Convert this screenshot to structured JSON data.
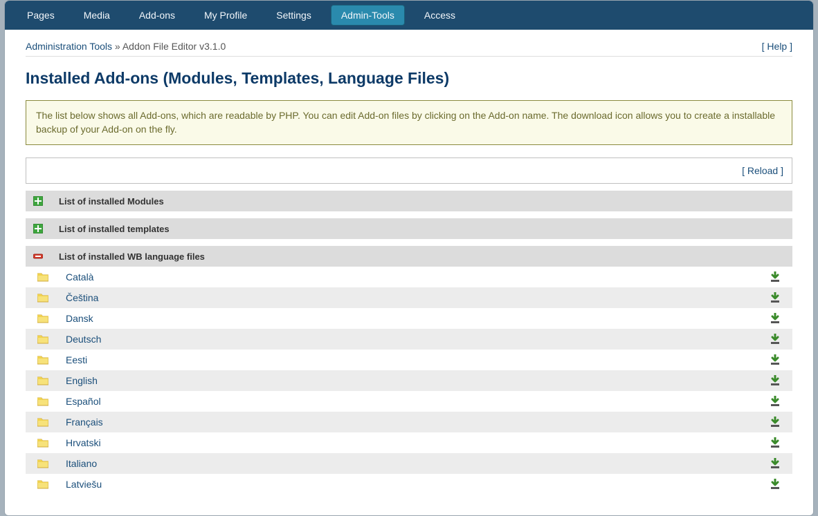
{
  "nav": {
    "items": [
      {
        "label": "Pages",
        "active": false
      },
      {
        "label": "Media",
        "active": false
      },
      {
        "label": "Add-ons",
        "active": false
      },
      {
        "label": "My Profile",
        "active": false
      },
      {
        "label": "Settings",
        "active": false
      },
      {
        "label": "Admin-Tools",
        "active": true
      },
      {
        "label": "Access",
        "active": false
      }
    ]
  },
  "breadcrumb": {
    "root": "Administration Tools",
    "sep": " » ",
    "current": "Addon File Editor v3.1.0"
  },
  "help_label": "[ Help ]",
  "page_title": "Installed Add-ons (Modules, Templates, Language Files)",
  "info_text": "The list below shows all Add-ons, which are readable by PHP. You can edit Add-on files by clicking on the Add-on name. The download icon allows you to create a installable backup of your Add-on on the fly.",
  "reload_label": "[ Reload ]",
  "sections": {
    "modules": {
      "title": "List of installed Modules",
      "expanded": false
    },
    "templates": {
      "title": "List of installed templates",
      "expanded": false
    },
    "languages": {
      "title": "List of installed WB language files",
      "expanded": true
    }
  },
  "languages": [
    {
      "name": "Català"
    },
    {
      "name": "Čeština"
    },
    {
      "name": "Dansk"
    },
    {
      "name": "Deutsch"
    },
    {
      "name": "Eesti"
    },
    {
      "name": "English"
    },
    {
      "name": "Español"
    },
    {
      "name": "Français"
    },
    {
      "name": "Hrvatski"
    },
    {
      "name": "Italiano"
    },
    {
      "name": "Latviešu"
    }
  ]
}
